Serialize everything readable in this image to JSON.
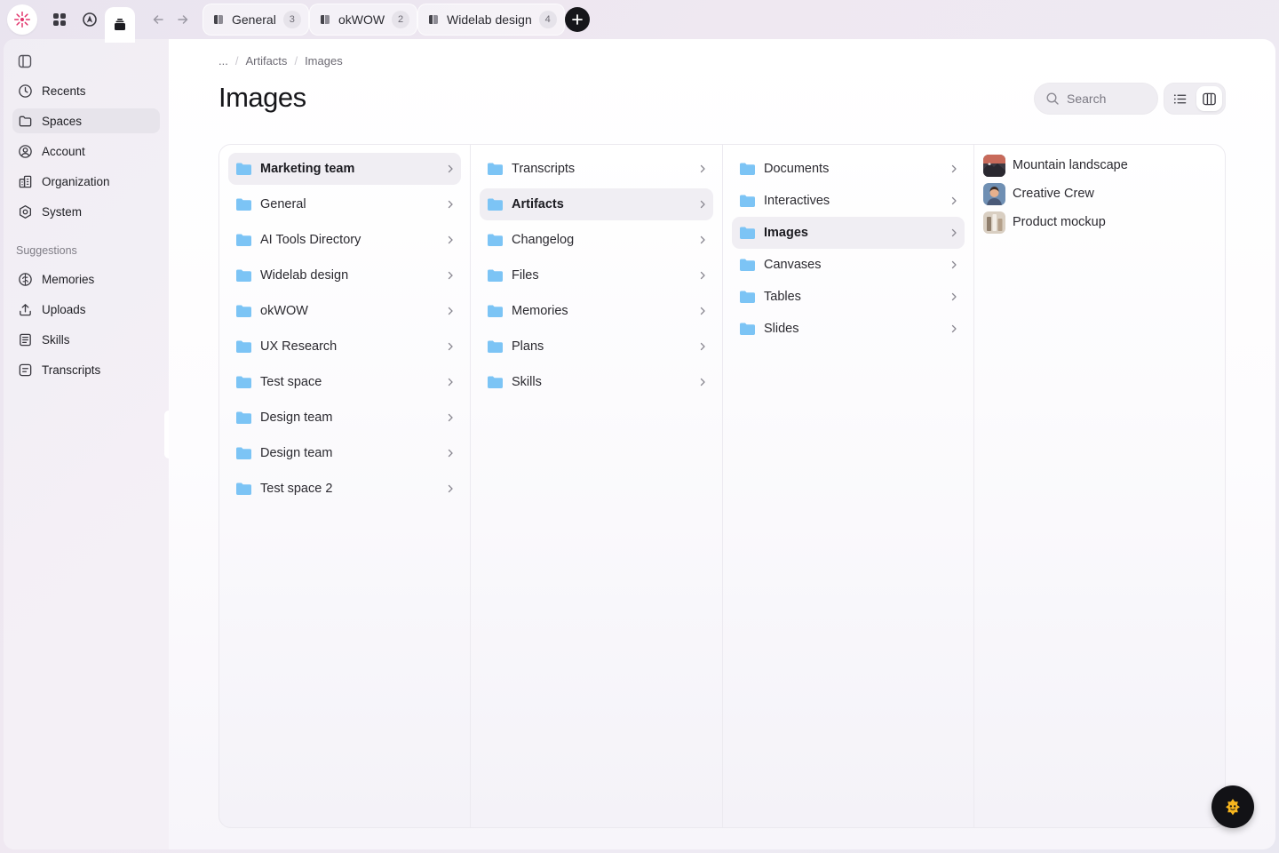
{
  "topbar": {
    "tabs": [
      {
        "label": "General",
        "count": "3"
      },
      {
        "label": "okWOW",
        "count": "2"
      },
      {
        "label": "Widelab design",
        "count": "4"
      }
    ]
  },
  "sidebar": {
    "items": [
      {
        "label": "Recents",
        "icon": "clock-icon"
      },
      {
        "label": "Spaces",
        "icon": "folder-icon"
      },
      {
        "label": "Account",
        "icon": "user-circle-icon"
      },
      {
        "label": "Organization",
        "icon": "building-icon"
      },
      {
        "label": "System",
        "icon": "settings-icon"
      }
    ],
    "suggestions_heading": "Suggestions",
    "suggestions": [
      {
        "label": "Memories",
        "icon": "brain-icon"
      },
      {
        "label": "Uploads",
        "icon": "upload-icon"
      },
      {
        "label": "Skills",
        "icon": "document-list-icon"
      },
      {
        "label": "Transcripts",
        "icon": "transcript-icon"
      }
    ]
  },
  "breadcrumb": {
    "ellipsis": "...",
    "items": [
      "Artifacts",
      "Images"
    ]
  },
  "page": {
    "title": "Images",
    "search_placeholder": "Search"
  },
  "columns": {
    "col1": [
      "Marketing team",
      "General",
      "AI Tools Directory",
      "Widelab design",
      "okWOW",
      "UX Research",
      "Test space",
      "Design team",
      "Design team",
      "Test space 2"
    ],
    "col2": [
      "Transcripts",
      "Artifacts",
      "Changelog",
      "Files",
      "Memories",
      "Plans",
      "Skills"
    ],
    "col3": [
      "Documents",
      "Interactives",
      "Images",
      "Canvases",
      "Tables",
      "Slides"
    ],
    "col4": [
      "Mountain landscape",
      "Creative Crew",
      "Product mockup"
    ]
  },
  "selection": {
    "col1": "Marketing team",
    "col2": "Artifacts",
    "col3": "Images"
  },
  "colors": {
    "folder": "#7cc4f5",
    "accent_dark": "#16161a",
    "logo": "#e2336b"
  }
}
